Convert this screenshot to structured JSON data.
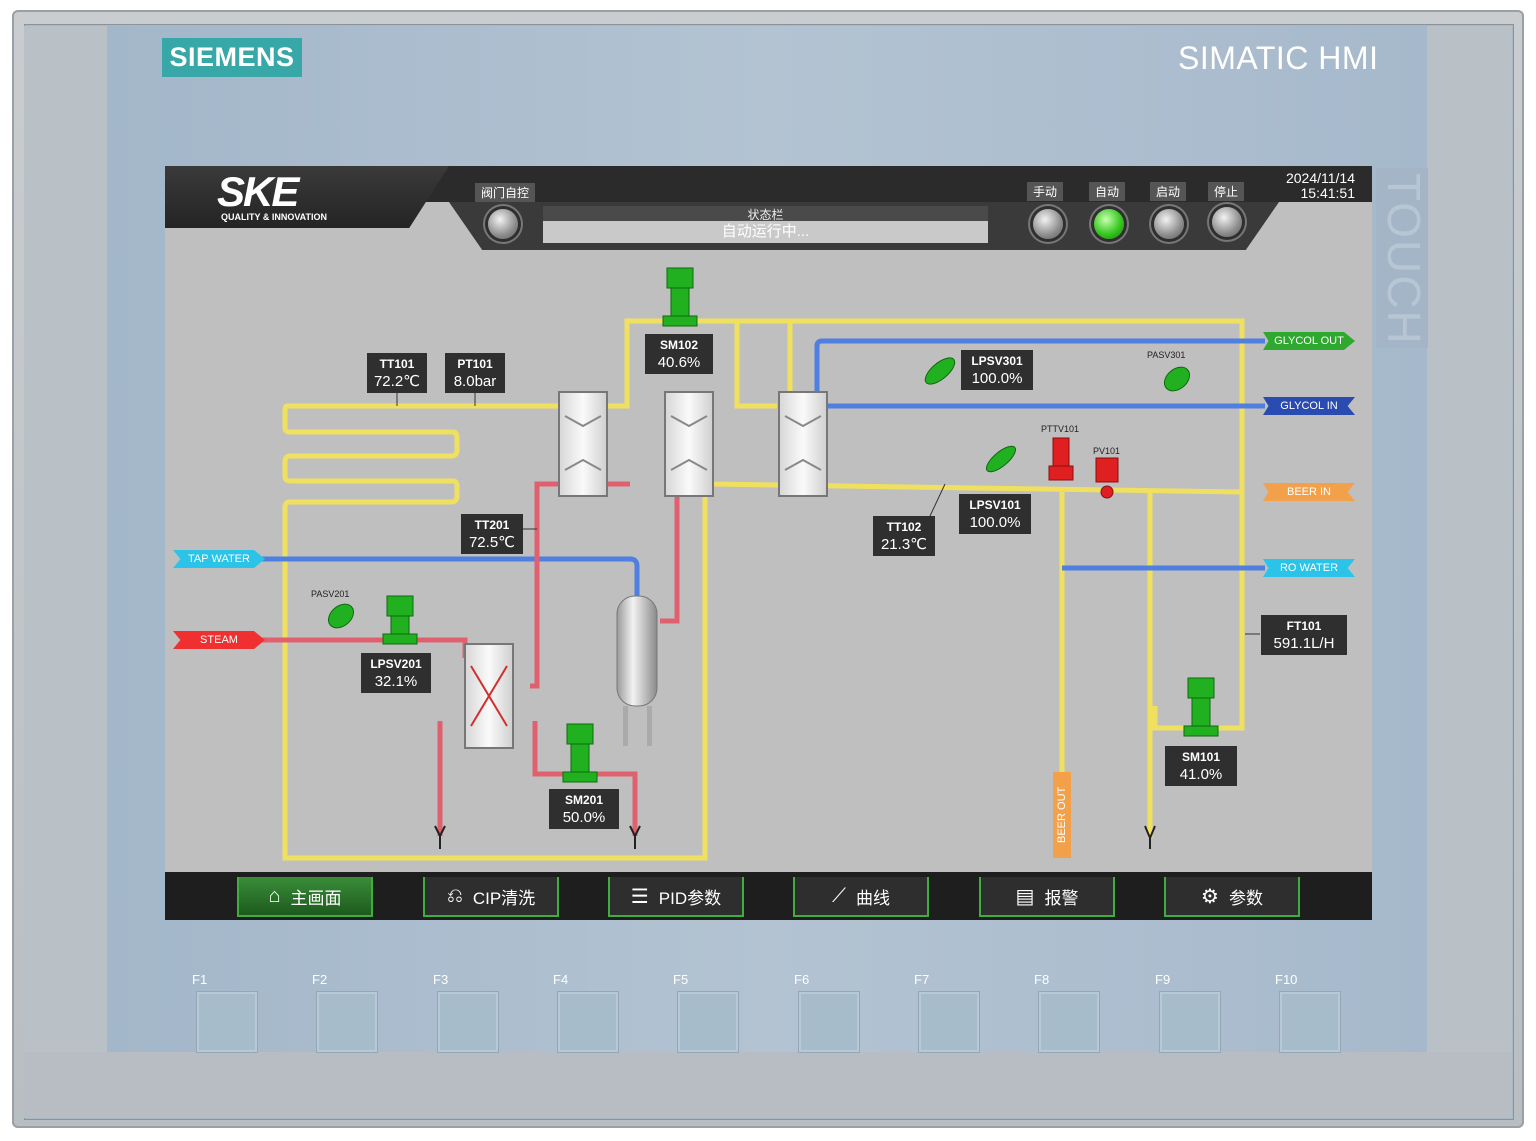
{
  "bezel": {
    "brand": "SIEMENS",
    "model": "SIMATIC HMI",
    "touch": "TOUCH"
  },
  "header": {
    "logo": "SKE",
    "logo_sub": "QUALITY & INNOVATION",
    "valve_manual_label": "阀门自控",
    "status_title": "状态栏",
    "status_text": "自动运行中...",
    "modes": {
      "manual": "手动",
      "auto": "自动",
      "start": "启动",
      "stop": "停止"
    },
    "date": "2024/11/14",
    "time": "15:41:51"
  },
  "tags": {
    "tt101": {
      "name": "TT101",
      "value": "72.2℃"
    },
    "pt101": {
      "name": "PT101",
      "value": "8.0bar"
    },
    "sm102": {
      "name": "SM102",
      "value": "40.6%"
    },
    "lpsv301": {
      "name": "LPSV301",
      "value": "100.0%"
    },
    "pasv301": {
      "name": "PASV301"
    },
    "pttv101": {
      "name": "PTTV101"
    },
    "pv101": {
      "name": "PV101"
    },
    "tt201": {
      "name": "TT201",
      "value": "72.5℃"
    },
    "tt102": {
      "name": "TT102",
      "value": "21.3℃"
    },
    "lpsv101": {
      "name": "LPSV101",
      "value": "100.0%"
    },
    "pasv201": {
      "name": "PASV201"
    },
    "lpsv201": {
      "name": "LPSV201",
      "value": "32.1%"
    },
    "sm201": {
      "name": "SM201",
      "value": "50.0%"
    },
    "ft101": {
      "name": "FT101",
      "value": "591.1L/H"
    },
    "sm101": {
      "name": "SM101",
      "value": "41.0%"
    }
  },
  "streams": {
    "glycol_out": "GLYCOL OUT",
    "glycol_in": "GLYCOL IN",
    "beer_in": "BEER IN",
    "ro_water": "RO WATER",
    "tap_water": "TAP WATER",
    "steam": "STEAM",
    "beer_out": "BEER OUT"
  },
  "colors": {
    "yellow_pipe": "#f0e060",
    "blue_pipe": "#4f7fe0",
    "red_pipe": "#e06070",
    "valve_green": "#20b020",
    "valve_red": "#e02020"
  },
  "nav": [
    {
      "label": "主画面",
      "icon": "home-icon",
      "active": true
    },
    {
      "label": "CIP清洗",
      "icon": "cip-icon"
    },
    {
      "label": "PID参数",
      "icon": "sliders-icon"
    },
    {
      "label": "曲线",
      "icon": "chart-icon"
    },
    {
      "label": "报警",
      "icon": "alarm-icon"
    },
    {
      "label": "参数",
      "icon": "gear-icon"
    }
  ],
  "fkeys": [
    "F1",
    "F2",
    "F3",
    "F4",
    "F5",
    "F6",
    "F7",
    "F8",
    "F9",
    "F10"
  ]
}
